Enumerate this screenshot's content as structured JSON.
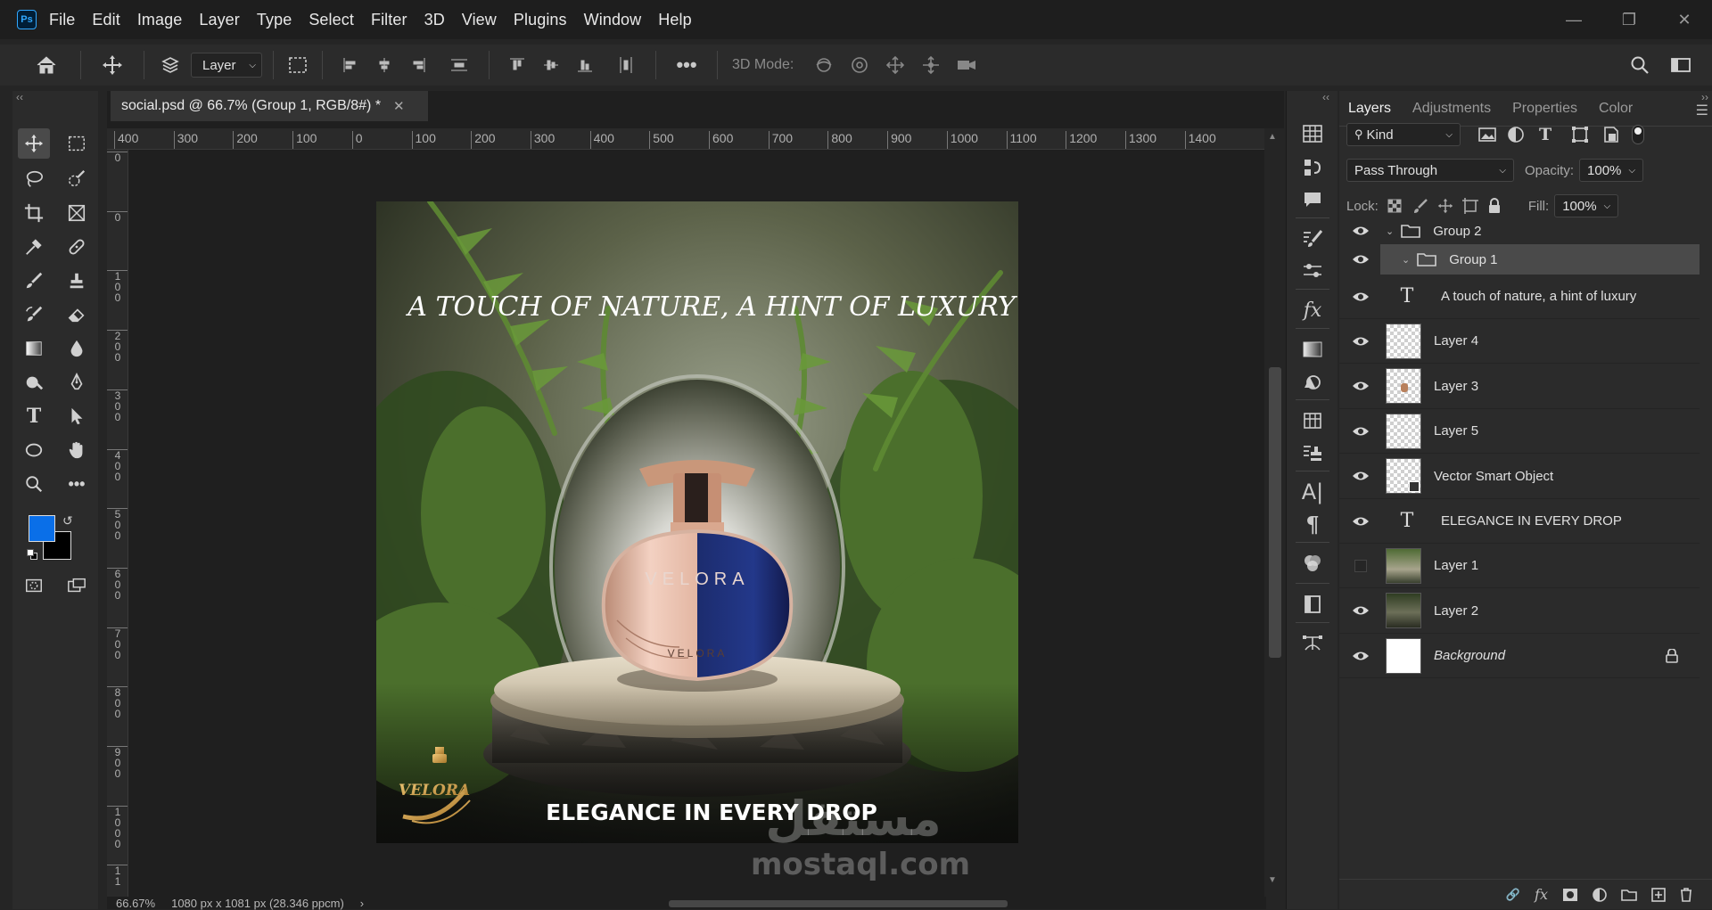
{
  "app": {
    "logo_text": "Ps",
    "menu": [
      "File",
      "Edit",
      "Image",
      "Layer",
      "Type",
      "Select",
      "Filter",
      "3D",
      "View",
      "Plugins",
      "Window",
      "Help"
    ]
  },
  "options": {
    "auto_select_value": "Layer",
    "mode_3d_label": "3D Mode:"
  },
  "document": {
    "tab_title": "social.psd @ 66.7% (Group 1, RGB/8#) *",
    "zoom": "66.67%",
    "doc_size": "1080 px x 1081 px (28.346 ppcm)",
    "ruler_h": [
      "400",
      "300",
      "200",
      "100",
      "0",
      "100",
      "200",
      "300",
      "400",
      "500",
      "600",
      "700",
      "800",
      "900",
      "1000",
      "1100",
      "1200",
      "1300",
      "1400"
    ],
    "ruler_v": [
      "0",
      "0",
      "1\n0\n0",
      "2\n0\n0",
      "3\n0\n0",
      "4\n0\n0",
      "5\n0\n0",
      "6\n0\n0",
      "7\n0\n0",
      "8\n0\n0",
      "9\n0\n0",
      "1\n0\n0\n0",
      "1\n1"
    ]
  },
  "artwork": {
    "headline": "A TOUCH OF NATURE, A HINT OF LUXURY",
    "tagline": "ELEGANCE IN EVERY DROP",
    "bottle_brand": "VELORA",
    "bottle_brand_small": "VELORA",
    "logo_text": "VELORA"
  },
  "colors": {
    "foreground": "#0a6fe8",
    "background": "#000000"
  },
  "watermark": {
    "arabic": "مستقل",
    "latin": "mostaql.com"
  },
  "layers_panel": {
    "tabs": [
      "Layers",
      "Adjustments",
      "Properties",
      "Color"
    ],
    "filter_kind": "Kind",
    "blend_mode": "Pass Through",
    "opacity_label": "Opacity:",
    "opacity_value": "100%",
    "lock_label": "Lock:",
    "fill_label": "Fill:",
    "fill_value": "100%",
    "group2": "Group 2",
    "group1": "Group 1",
    "layers": [
      {
        "name": "A touch of nature, a hint of luxury",
        "kind": "text",
        "visible": true
      },
      {
        "name": "Layer 4",
        "kind": "pixel",
        "visible": true
      },
      {
        "name": "Layer 3",
        "kind": "pixel",
        "visible": true
      },
      {
        "name": "Layer 5",
        "kind": "pixel",
        "visible": true
      },
      {
        "name": "Vector Smart Object",
        "kind": "smart",
        "visible": true
      },
      {
        "name": "ELEGANCE IN EVERY DROP",
        "kind": "text",
        "visible": true
      },
      {
        "name": "Layer 1",
        "kind": "image",
        "visible": false
      },
      {
        "name": "Layer 2",
        "kind": "image",
        "visible": true
      },
      {
        "name": "Background",
        "kind": "background",
        "visible": true
      }
    ]
  }
}
